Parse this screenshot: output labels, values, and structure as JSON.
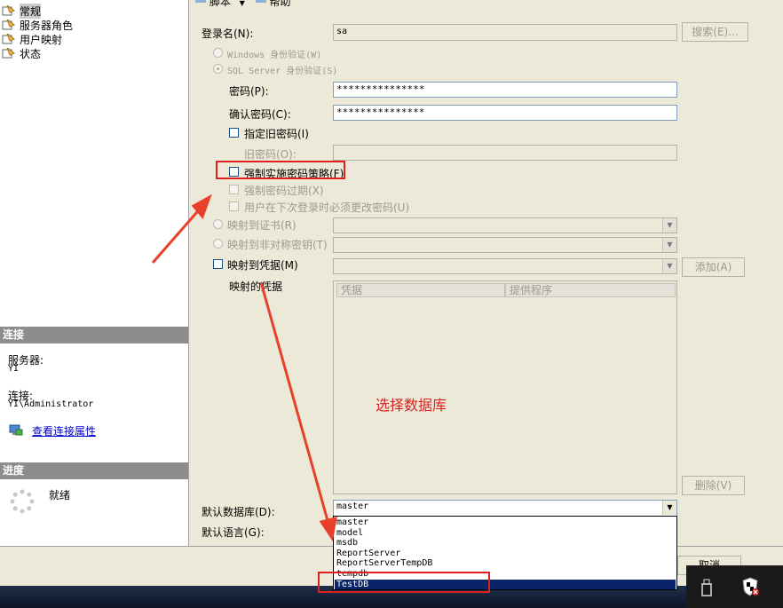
{
  "left": {
    "nav_items": [
      {
        "label": "常规",
        "selected": true
      },
      {
        "label": "服务器角色",
        "selected": false
      },
      {
        "label": "用户映射",
        "selected": false
      },
      {
        "label": "状态",
        "selected": false
      }
    ],
    "connection_header": "连接",
    "server_label": "服务器:",
    "server_value": "YI",
    "connection_label": "连接:",
    "connection_value": "YI\\Administrator",
    "view_props_link": "查看连接属性",
    "progress_header": "进度",
    "progress_status": "就绪"
  },
  "form": {
    "login_name_label": "登录名(N):",
    "login_name_value": "sa",
    "search_button": "搜索(E)...",
    "windows_auth": "Windows 身份验证(W)",
    "sql_auth": "SQL Server 身份验证(S)",
    "password_label": "密码(P):",
    "password_value": "***************",
    "confirm_label": "确认密码(C):",
    "confirm_value": "***************",
    "specify_old": "指定旧密码(I)",
    "old_password_label": "旧密码(O):",
    "enforce_policy": "强制实施密码策略(F)",
    "enforce_expiration": "强制密码过期(X)",
    "must_change": "用户在下次登录时必须更改密码(U)",
    "map_cert": "映射到证书(R)",
    "map_asym": "映射到非对称密钥(T)",
    "map_cred": "映射到凭据(M)",
    "add_button": "添加(A)",
    "mapped_creds_label": "映射的凭据",
    "col_credential": "凭据",
    "col_provider": "提供程序",
    "remove_button": "删除(V)",
    "default_db_label": "默认数据库(D):",
    "default_db_value": "master",
    "default_lang_label": "默认语言(G):",
    "annotation": "选择数据库"
  },
  "toolbar": {
    "script_label": "脚本",
    "help_label": "帮助"
  },
  "dropdown": {
    "options": [
      "master",
      "model",
      "msdb",
      "ReportServer",
      "ReportServerTempDB",
      "tempdb",
      "TestDB"
    ],
    "selected_index": 6
  },
  "footer": {
    "cancel_button": "取消"
  },
  "colors": {
    "highlight": "#e02020",
    "selection": "#0a246a",
    "link": "#0000cc"
  }
}
